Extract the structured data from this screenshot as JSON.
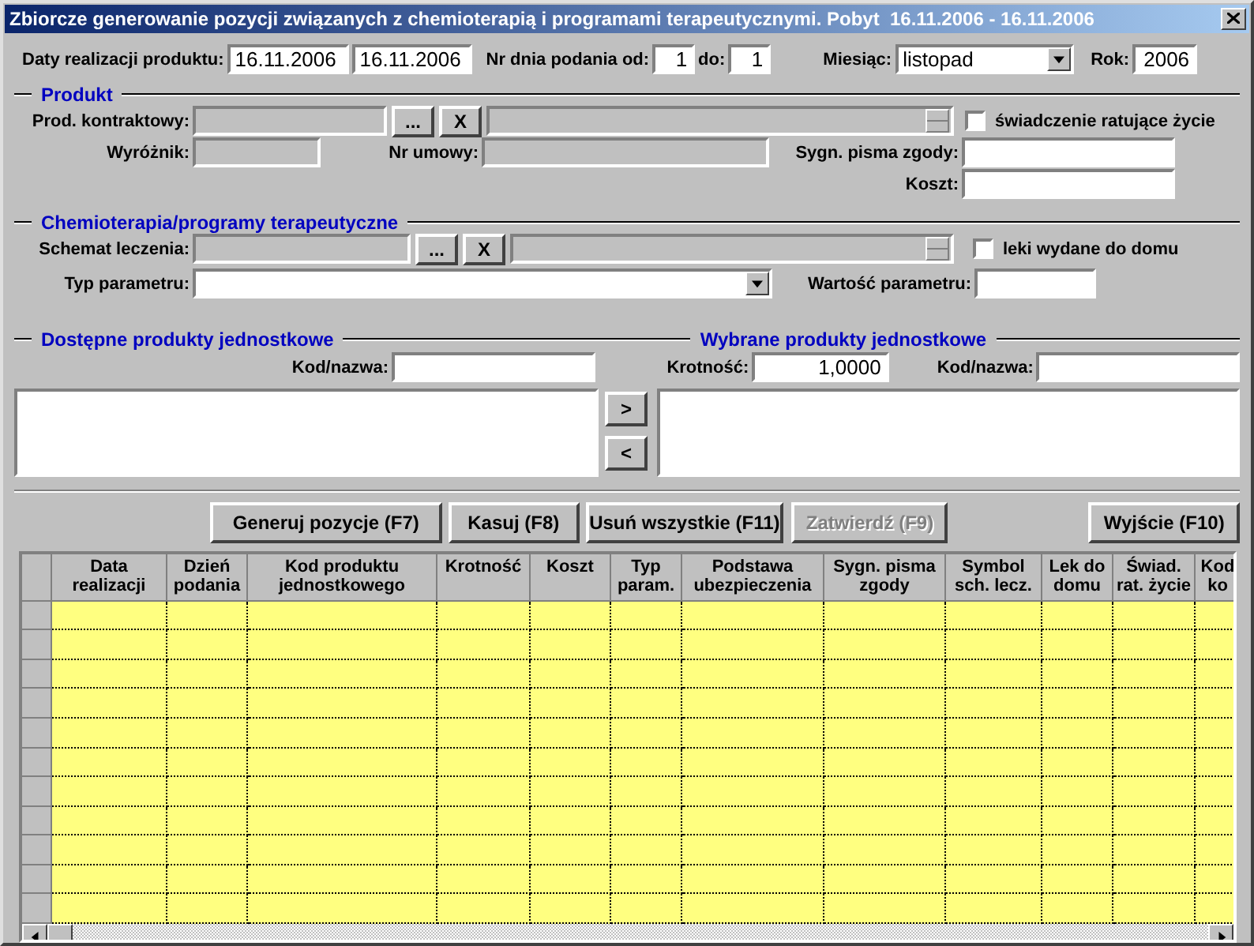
{
  "window": {
    "title": "Zbiorcze generowanie pozycji związanych z chemioterapią i programami terapeutycznymi. Pobyt  16.11.2006 - 16.11.2006"
  },
  "header": {
    "dates_label": "Daty realizacji produktu:",
    "date_from": {
      "value": "16.11.2006",
      "disabled": false
    },
    "date_to": {
      "value": "16.11.2006",
      "disabled": false
    },
    "day_label": "Nr dnia podania od:",
    "day_from": {
      "value": "1",
      "disabled": false
    },
    "day_to_label": "do:",
    "day_to": {
      "value": "1",
      "disabled": false
    },
    "month_label": "Miesiąc:",
    "month": {
      "value": "listopad",
      "disabled": false
    },
    "year_label": "Rok:",
    "year": {
      "value": "2006",
      "disabled": false
    }
  },
  "product": {
    "title": "Produkt",
    "contract_label": "Prod. kontraktowy:",
    "contract_code": {
      "disabled": true
    },
    "browse_button": "...",
    "clear_button": "X",
    "contract_name": {
      "disabled": true
    },
    "lifesaving": {
      "label": "świadczenie ratujące życie",
      "checked": false
    },
    "marker_label": "Wyróżnik:",
    "marker": {
      "disabled": true
    },
    "contract_no_label": "Nr umowy:",
    "contract_no": {
      "disabled": true
    },
    "consent_label": "Sygn. pisma zgody:",
    "consent": {
      "disabled": false
    },
    "cost_label": "Koszt:",
    "cost": {
      "disabled": false
    }
  },
  "chemotherapy": {
    "title": "Chemioterapia/programy terapeutyczne",
    "scheme_label": "Schemat leczenia:",
    "scheme_code": {
      "disabled": true
    },
    "browse_button": "...",
    "clear_button": "X",
    "scheme_name": {
      "disabled": true
    },
    "take_home": {
      "label": "leki wydane do domu",
      "checked": false
    },
    "param_type_label": "Typ parametru:",
    "param_type": {
      "disabled": false
    },
    "param_value_label": "Wartość parametru:",
    "param_value": {
      "disabled": false
    }
  },
  "available": {
    "title": "Dostępne produkty jednostkowe",
    "search_label": "Kod/nazwa:",
    "search": {
      "disabled": false
    }
  },
  "selected": {
    "title": "Wybrane produkty jednostkowe",
    "multiplicity_label": "Krotność:",
    "multiplicity": {
      "value": "1,0000",
      "disabled": false
    },
    "search_label": "Kod/nazwa:",
    "search": {
      "disabled": false
    }
  },
  "move_buttons": [
    ">",
    "<"
  ],
  "actions": [
    {
      "label": "Generuj pozycje (F7)",
      "disabled": false
    },
    {
      "label": "Kasuj (F8)",
      "disabled": false
    },
    {
      "label": "Usuń wszystkie (F11)",
      "disabled": false
    },
    {
      "label": "Zatwierdź (F9)",
      "disabled": true
    },
    {
      "label": "Wyjście (F10)",
      "disabled": false
    }
  ],
  "table": {
    "columns": [
      "Data realizacji",
      "Dzień podania",
      "Kod produktu jednostkowego",
      "Krotność",
      "Koszt",
      "Typ param.",
      "Podstawa ubezpieczenia",
      "Sygn. pisma zgody",
      "Symbol sch. lecz.",
      "Lek do domu",
      "Świad. rat. życie",
      "Kod ko"
    ]
  }
}
